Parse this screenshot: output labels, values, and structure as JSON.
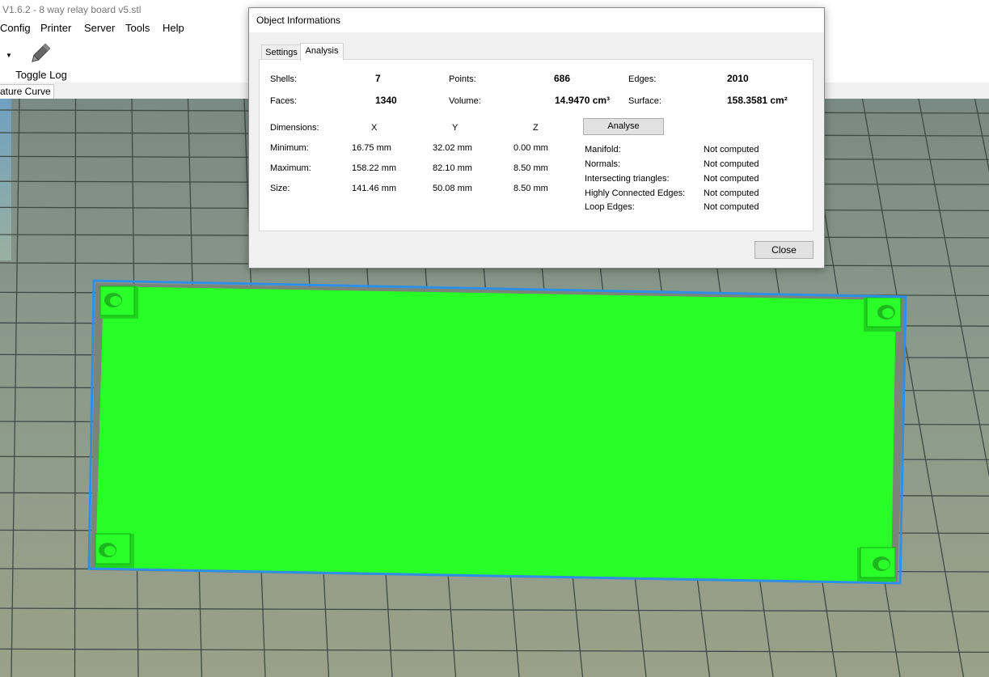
{
  "window": {
    "title": "V1.6.2 - 8 way relay board v5.stl"
  },
  "menu": [
    "Config",
    "Printer",
    "Server",
    "Tools",
    "Help"
  ],
  "toolbar": {
    "toggle_log_label": "Toggle Log"
  },
  "view_tab": {
    "label": "ature Curve"
  },
  "colors": {
    "model": "#27ff27",
    "selection": "#2f8fe6",
    "grid_line": "#3f4a45"
  },
  "dialog": {
    "title": "Object Informations",
    "tabs": [
      "Settings",
      "Analysis"
    ],
    "active_tab": "Analysis",
    "stats": {
      "shells_label": "Shells:",
      "shells": "7",
      "points_label": "Points:",
      "points": "686",
      "edges_label": "Edges:",
      "edges": "2010",
      "faces_label": "Faces:",
      "faces": "1340",
      "volume_label": "Volume:",
      "volume": "14.9470 cm³",
      "surface_label": "Surface:",
      "surface": "158.3581 cm²"
    },
    "dimensions": {
      "label": "Dimensions:",
      "axes": [
        "X",
        "Y",
        "Z"
      ],
      "rows": [
        {
          "label": "Minimum:",
          "values": [
            "16.75 mm",
            "32.02 mm",
            "0.00 mm"
          ]
        },
        {
          "label": "Maximum:",
          "values": [
            "158.22 mm",
            "82.10 mm",
            "8.50 mm"
          ]
        },
        {
          "label": "Size:",
          "values": [
            "141.46 mm",
            "50.08 mm",
            "8.50 mm"
          ]
        }
      ]
    },
    "analyse_button": "Analyse",
    "checks": [
      {
        "label": "Manifold:",
        "value": "Not computed"
      },
      {
        "label": "Normals:",
        "value": "Not computed"
      },
      {
        "label": "Intersecting triangles:",
        "value": "Not computed"
      },
      {
        "label": "Highly Connected Edges:",
        "value": "Not computed"
      },
      {
        "label": "Loop Edges:",
        "value": "Not computed"
      }
    ],
    "close_button": "Close"
  }
}
